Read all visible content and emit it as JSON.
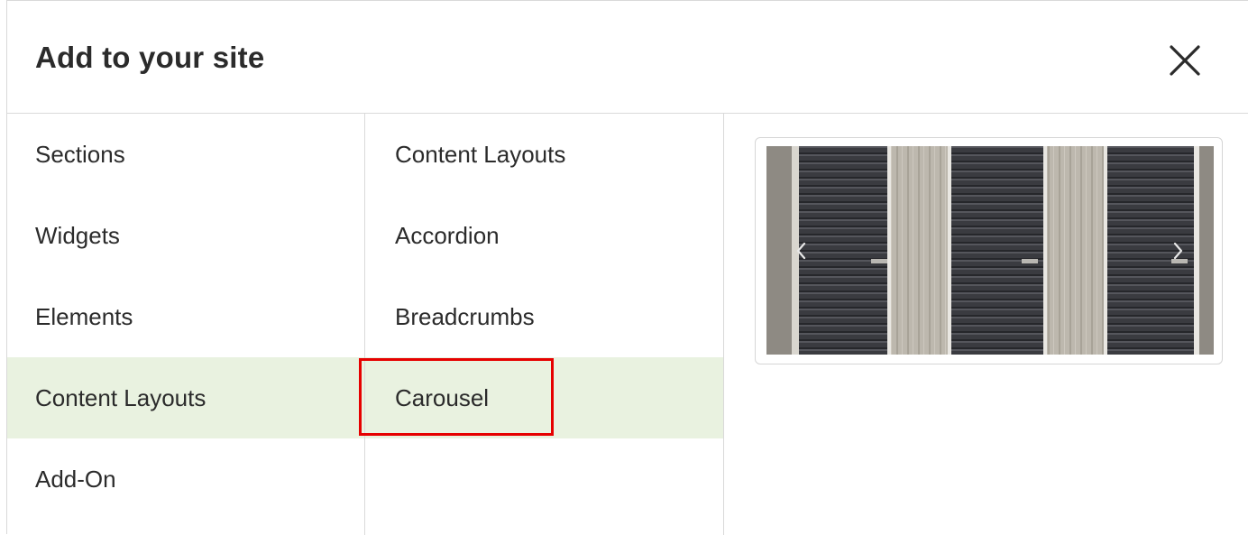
{
  "dialog": {
    "title": "Add to your site",
    "close_icon": "close-icon"
  },
  "categories": [
    {
      "label": "Sections",
      "active": false
    },
    {
      "label": "Widgets",
      "active": false
    },
    {
      "label": "Elements",
      "active": false
    },
    {
      "label": "Content Layouts",
      "active": true
    },
    {
      "label": "Add-On",
      "active": false
    }
  ],
  "subitems": [
    {
      "label": "Content Layouts"
    },
    {
      "label": "Accordion"
    },
    {
      "label": "Breadcrumbs"
    },
    {
      "label": "Carousel",
      "selected": true
    }
  ],
  "preview": {
    "image_description_icon": "carousel-preview-image",
    "prev_icon": "chevron-left-icon",
    "next_icon": "chevron-right-icon"
  },
  "colors": {
    "active_row_bg": "#e9f2e0",
    "highlight_border": "#e60000",
    "divider": "#d9d9d9"
  }
}
